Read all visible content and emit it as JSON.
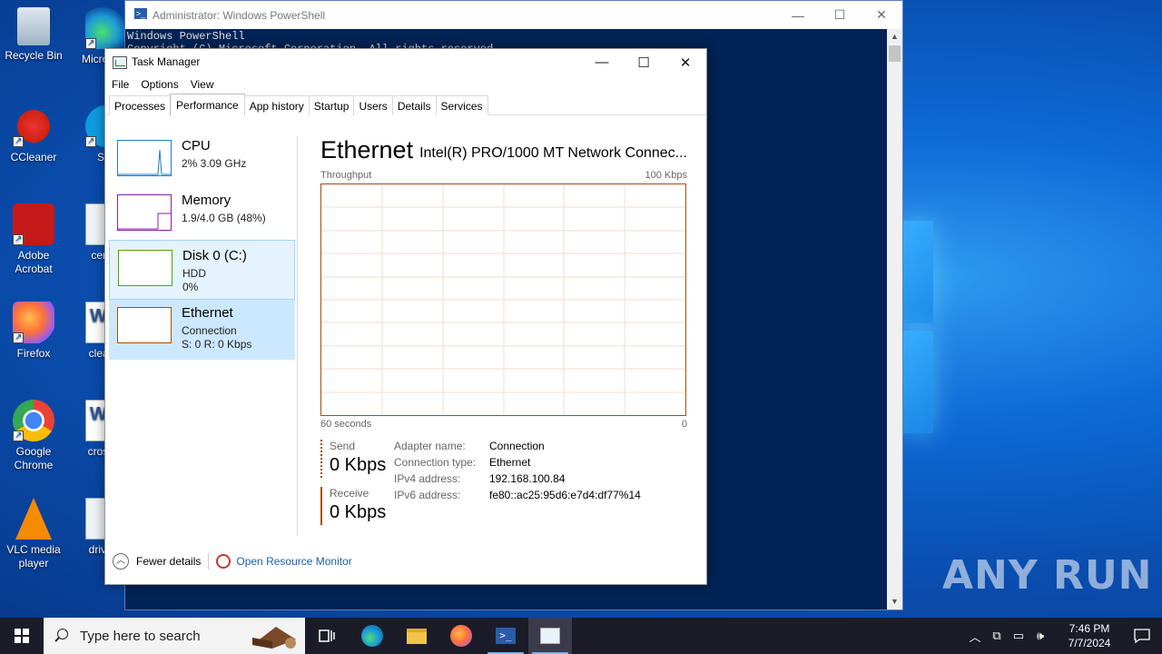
{
  "desktop": {
    "icons_col1": [
      {
        "label": "Recycle Bin",
        "icon": "recycle-bin-icon"
      },
      {
        "label": "CCleaner",
        "icon": "ccleaner-icon"
      },
      {
        "label": "Adobe Acrobat",
        "icon": "acrobat-icon"
      },
      {
        "label": "Firefox",
        "icon": "firefox-icon"
      },
      {
        "label": "Google Chrome",
        "icon": "chrome-icon"
      },
      {
        "label": "VLC media player",
        "icon": "vlc-icon"
      }
    ],
    "icons_col2": [
      {
        "label": "Micro Edg",
        "icon": "edge-icon"
      },
      {
        "label": "Sky",
        "icon": "skype-icon"
      },
      {
        "label": "centra",
        "icon": "image-file-icon"
      },
      {
        "label": "clearco",
        "icon": "word-doc-icon"
      },
      {
        "label": "crosssk",
        "icon": "word-doc-icon"
      },
      {
        "label": "driveca",
        "icon": "image-file-icon"
      }
    ],
    "watermark": "ANY RUN"
  },
  "powershell": {
    "title": "Administrator: Windows PowerShell",
    "lines": [
      "Windows PowerShell",
      "Copyright (C) Microsoft Corporation. All rights reserved."
    ]
  },
  "taskmanager": {
    "title": "Task Manager",
    "menu": [
      "File",
      "Options",
      "View"
    ],
    "tabs": [
      "Processes",
      "Performance",
      "App history",
      "Startup",
      "Users",
      "Details",
      "Services"
    ],
    "active_tab": "Performance",
    "side": [
      {
        "name": "CPU",
        "s1": "2%  3.09 GHz",
        "s2": "",
        "color": "#1e7cc9"
      },
      {
        "name": "Memory",
        "s1": "1.9/4.0 GB (48%)",
        "s2": "",
        "color": "#8b1ca6"
      },
      {
        "name": "Disk 0 (C:)",
        "s1": "HDD",
        "s2": "0%",
        "color": "#4da60c"
      },
      {
        "name": "Ethernet",
        "s1": "Connection",
        "s2": "S: 0  R: 0 Kbps",
        "color": "#a74f01"
      }
    ],
    "main": {
      "title": "Ethernet",
      "adapter": "Intel(R) PRO/1000 MT Network Connec...",
      "throughput_label": "Throughput",
      "max_label": "100 Kbps",
      "time_label": "60 seconds",
      "min_label": "0",
      "send_label": "Send",
      "send_value": "0 Kbps",
      "recv_label": "Receive",
      "recv_value": "0 Kbps",
      "props": [
        {
          "k": "Adapter name:",
          "v": "Connection"
        },
        {
          "k": "Connection type:",
          "v": "Ethernet"
        },
        {
          "k": "IPv4 address:",
          "v": "192.168.100.84"
        },
        {
          "k": "IPv6 address:",
          "v": "fe80::ac25:95d6:e7d4:df77%14"
        }
      ]
    },
    "fewer_details": "Fewer details",
    "open_rm": "Open Resource Monitor"
  },
  "taskbar": {
    "search_placeholder": "Type here to search",
    "time": "7:46 PM",
    "date": "7/7/2024"
  }
}
